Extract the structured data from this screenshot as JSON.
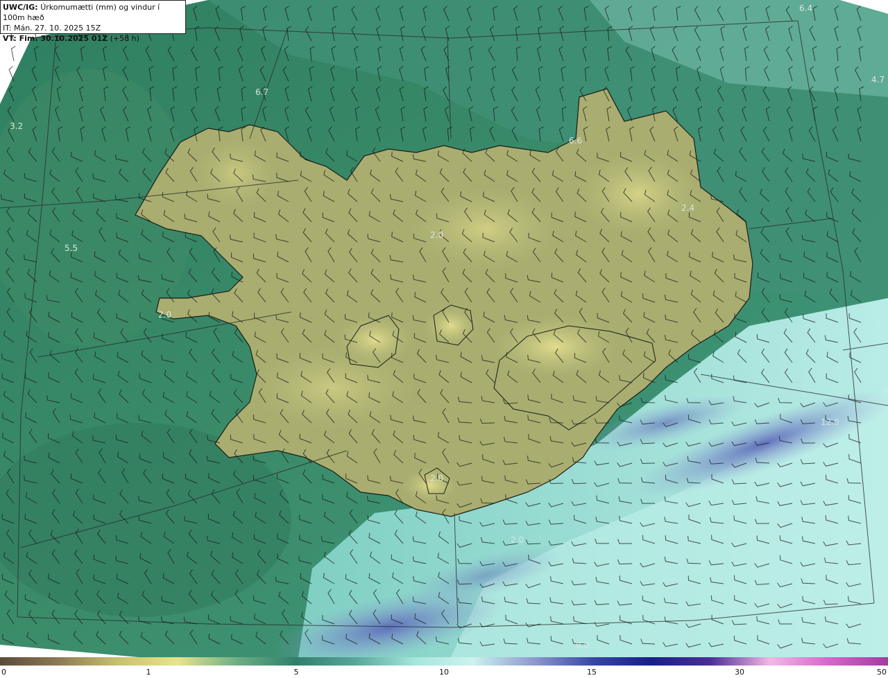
{
  "header": {
    "model": "UWC/IG:",
    "title": "Úrkomumætti (mm) og vindur í 100m hæð",
    "issue_time": "IT: Mán. 27. 10. 2025 15Z",
    "valid_prefix": "VT: Fim. 30.10.2025 01Z",
    "valid_suffix": "(+58 h)"
  },
  "map_labels": [
    "6.4",
    "4.7",
    "6.7",
    "3.2",
    "6.6",
    "2.4",
    "5.5",
    "2.0",
    "2.0",
    "2.0",
    "12.9",
    "2.0",
    "8.0"
  ],
  "legend": {
    "ticks": [
      "0",
      "1",
      "5",
      "10",
      "15",
      "30",
      "50"
    ],
    "colors": [
      "#5c4a38",
      "#8e7a55",
      "#c9c170",
      "#e8e38e",
      "#6fae85",
      "#2f7f6a",
      "#58a69a",
      "#a5e6dc",
      "#cdf2ee",
      "#8f9ad0",
      "#3a47a4",
      "#181f86",
      "#4b2f96",
      "#f2b8e6",
      "#d865cc",
      "#a33ba1"
    ]
  }
}
